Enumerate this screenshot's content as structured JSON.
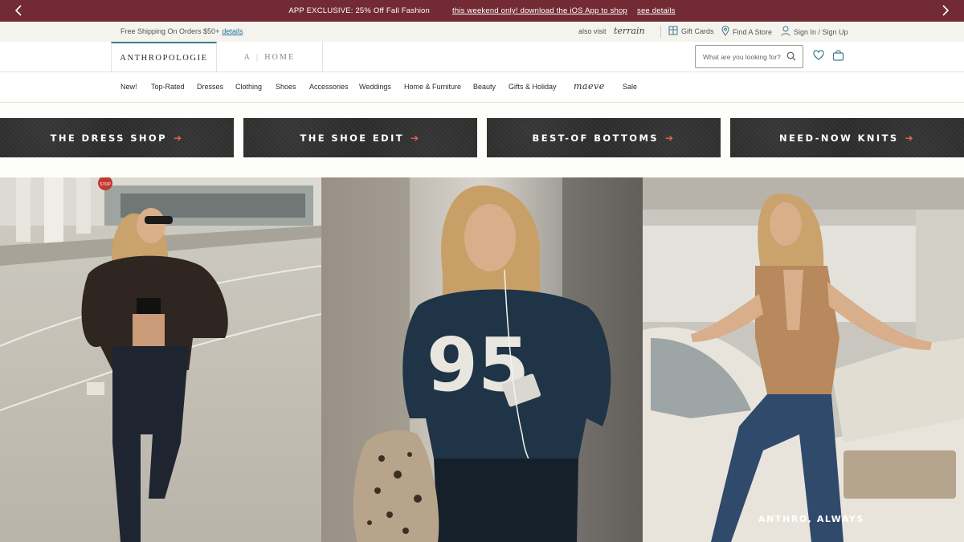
{
  "promo": {
    "headline": "APP EXCLUSIVE: 25% Off Fall Fashion",
    "link": "this weekend only! download the iOS App to shop",
    "details": "see details"
  },
  "utility": {
    "shipping_text": "Free Shipping On Orders $50+",
    "shipping_link": "details",
    "also_visit": "also visit",
    "terrain": "terrain",
    "gift_cards": "Gift Cards",
    "find_store": "Find A Store",
    "sign_in": "Sign In / Sign Up"
  },
  "header": {
    "brand": "ANTHROPOLOGIE",
    "home_tab_a": "A",
    "home_tab_home": "HOME",
    "search_placeholder": "What are you looking for?"
  },
  "nav": {
    "items": [
      "New!",
      "Top-Rated",
      "Dresses",
      "Clothing",
      "Shoes",
      "Accessories",
      "Weddings",
      "Home & Furniture",
      "Beauty",
      "Gifts & Holiday",
      "maeve",
      "Sale"
    ]
  },
  "categories": [
    {
      "label": "THE DRESS SHOP"
    },
    {
      "label": "THE SHOE EDIT"
    },
    {
      "label": "BEST-OF BOTTOMS"
    },
    {
      "label": "NEED-NOW KNITS"
    }
  ],
  "hero": {
    "caption": "ANTHRO, ALWAYS",
    "jersey_number": "95",
    "stop_sign": "STOP"
  },
  "colors": {
    "promo_bg": "#722a34",
    "accent_teal": "#3a7a8c",
    "arrow_coral": "#e8664a"
  }
}
